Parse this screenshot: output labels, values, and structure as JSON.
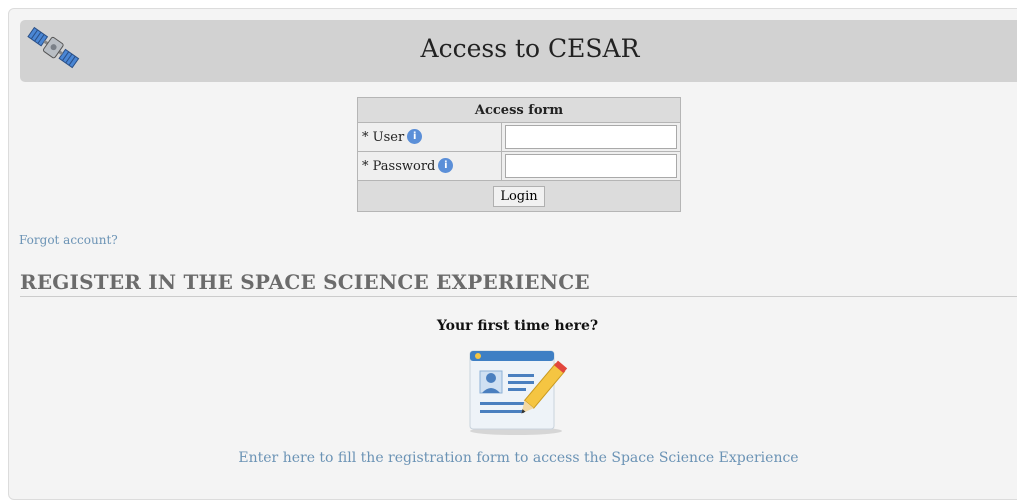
{
  "header": {
    "title": "Access to CESAR",
    "icon": "satellite-icon"
  },
  "access_form": {
    "title": "Access form",
    "user_label": "* User",
    "password_label": "* Password",
    "user_value": "",
    "password_value": "",
    "login_label": "Login",
    "info_icon": "info-icon"
  },
  "forgot_link": "Forgot account?",
  "register": {
    "heading": "REGISTER IN THE SPACE SCIENCE EXPERIENCE",
    "first_time": "Your first time here?",
    "icon": "registration-form-icon",
    "link": "Enter here to fill the registration form to access the Space Science Experience"
  },
  "colors": {
    "link": "#6b93b5",
    "header_bg": "#d2d2d2",
    "panel_bg": "#f4f4f4"
  }
}
